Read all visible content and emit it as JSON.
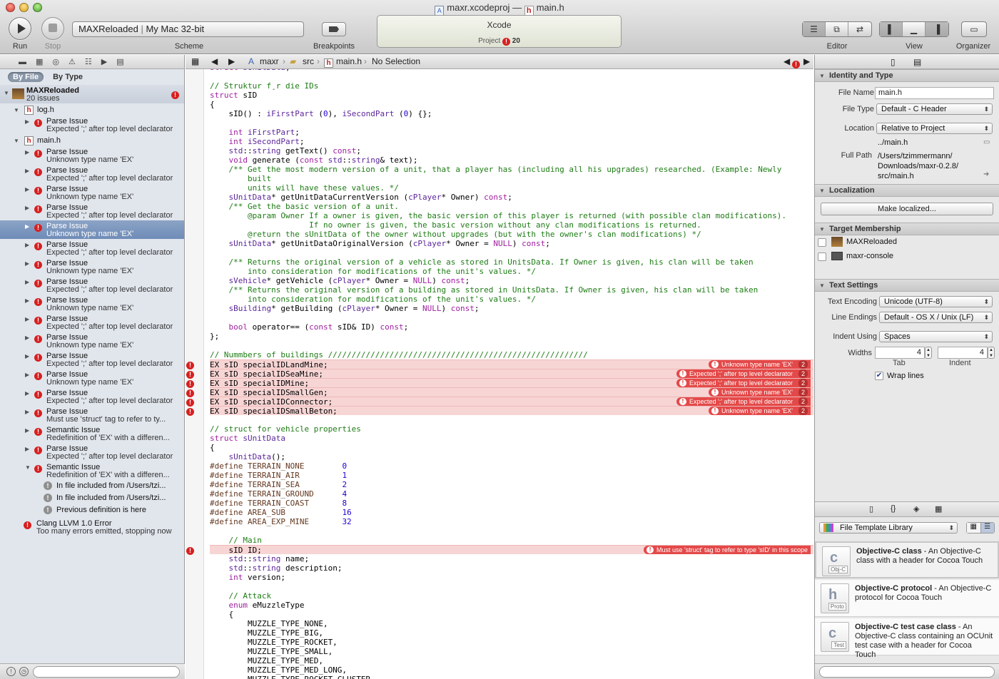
{
  "window": {
    "title_file1": "maxr.xcodeproj",
    "title_sep": "—",
    "title_file2": "main.h"
  },
  "toolbar": {
    "run_label": "Run",
    "stop_label": "Stop",
    "scheme_target": "MAXReloaded",
    "scheme_dest": "My Mac 32-bit",
    "scheme_label": "Scheme",
    "breakpoints_label": "Breakpoints",
    "activity_title": "Xcode",
    "activity_project": "Project",
    "activity_errors": "20",
    "editor_label": "Editor",
    "view_label": "View",
    "organizer_label": "Organizer"
  },
  "navigator": {
    "scope_by_file": "By File",
    "scope_by_type": "By Type",
    "project_name": "MAXReloaded",
    "project_issues": "20 issues",
    "files": [
      {
        "name": "log.h",
        "issues": [
          {
            "title": "Parse Issue",
            "detail": "Expected ';' after top level declarator"
          }
        ]
      },
      {
        "name": "main.h",
        "issues": [
          {
            "title": "Parse Issue",
            "detail": "Unknown type name 'EX'"
          },
          {
            "title": "Parse Issue",
            "detail": "Expected ';' after top level declarator"
          },
          {
            "title": "Parse Issue",
            "detail": "Unknown type name 'EX'"
          },
          {
            "title": "Parse Issue",
            "detail": "Expected ';' after top level declarator"
          },
          {
            "title": "Parse Issue",
            "detail": "Unknown type name 'EX'"
          },
          {
            "title": "Parse Issue",
            "detail": "Expected ';' after top level declarator"
          },
          {
            "title": "Parse Issue",
            "detail": "Unknown type name 'EX'"
          },
          {
            "title": "Parse Issue",
            "detail": "Expected ';' after top level declarator"
          },
          {
            "title": "Parse Issue",
            "detail": "Unknown type name 'EX'"
          },
          {
            "title": "Parse Issue",
            "detail": "Expected ';' after top level declarator"
          },
          {
            "title": "Parse Issue",
            "detail": "Unknown type name 'EX'"
          },
          {
            "title": "Parse Issue",
            "detail": "Expected ';' after top level declarator"
          },
          {
            "title": "Parse Issue",
            "detail": "Unknown type name 'EX'"
          },
          {
            "title": "Parse Issue",
            "detail": "Expected ';' after top level declarator"
          },
          {
            "title": "Parse Issue",
            "detail": "Must use 'struct' tag to refer to ty..."
          },
          {
            "title": "Semantic Issue",
            "detail": "Redefinition of 'EX' with a differen..."
          },
          {
            "title": "Parse Issue",
            "detail": "Expected ';' after top level declarator"
          },
          {
            "title": "Semantic Issue",
            "detail": "Redefinition of 'EX' with a differen..."
          }
        ]
      },
      {
        "notes": [
          "In file included from /Users/tzi...",
          "In file included from /Users/tzi...",
          "Previous definition is here"
        ]
      }
    ],
    "clang_title": "Clang LLVM 1.0 Error",
    "clang_detail": "Too many errors emitted, stopping now",
    "selected_index": 5
  },
  "jumpbar": {
    "project": "maxr",
    "folder": "src",
    "file": "main.h",
    "symbol": "No Selection"
  },
  "code": {
    "lines": [
      "struct sUnitData;",
      "",
      "// Struktur f¸r die IDs",
      "struct sID",
      "{",
      "    sID() : iFirstPart (0), iSecondPart (0) {};",
      "",
      "    int iFirstPart;",
      "    int iSecondPart;",
      "    std::string getText() const;",
      "    void generate (const std::string& text);",
      "    /** Get the most modern version of a unit, that a player has (including all his upgrades) researched. (Example: Newly",
      "        built",
      "        units will have these values. */",
      "    sUnitData* getUnitDataCurrentVersion (cPlayer* Owner) const;",
      "    /** Get the basic version of a unit.",
      "        @param Owner If a owner is given, the basic version of this player is returned (with possible clan modifications).",
      "                     If no owner is given, the basic version without any clan modifications is returned.",
      "        @return the sUnitData of the owner without upgrades (but with the owner's clan modifications) */",
      "    sUnitData* getUnitDataOriginalVersion (cPlayer* Owner = NULL) const;",
      "",
      "    /** Returns the original version of a vehicle as stored in UnitsData. If Owner is given, his clan will be taken",
      "        into consideration for modifications of the unit's values. */",
      "    sVehicle* getVehicle (cPlayer* Owner = NULL) const;",
      "    /** Returns the original version of a building as stored in UnitsData. If Owner is given, his clan will be taken",
      "        into consideration for modifications of the unit's values. */",
      "    sBuilding* getBuilding (cPlayer* Owner = NULL) const;",
      "",
      "    bool operator== (const sID& ID) const;",
      "};",
      "",
      "// Nummbers of buildings ///////////////////////////////////////////////////////",
      "EX sID specialIDLandMine;",
      "EX sID specialIDSeaMine;",
      "EX sID specialIDMine;",
      "EX sID specialIDSmallGen;",
      "EX sID specialIDConnector;",
      "EX sID specialIDSmallBeton;",
      "",
      "// struct for vehicle properties",
      "struct sUnitData",
      "{",
      "    sUnitData();",
      "#define TERRAIN_NONE        0",
      "#define TERRAIN_AIR         1",
      "#define TERRAIN_SEA         2",
      "#define TERRAIN_GROUND      4",
      "#define TERRAIN_COAST       8",
      "#define AREA_SUB            16",
      "#define AREA_EXP_MINE       32",
      "",
      "    // Main",
      "    sID ID;",
      "    std::string name;",
      "    std::string description;",
      "    int version;",
      "",
      "    // Attack",
      "    enum eMuzzleType",
      "    {",
      "        MUZZLE_TYPE_NONE,",
      "        MUZZLE_TYPE_BIG,",
      "        MUZZLE_TYPE_ROCKET,",
      "        MUZZLE_TYPE_SMALL,",
      "        MUZZLE_TYPE_MED,",
      "        MUZZLE_TYPE_MED_LONG,",
      "        MUZZLE_TYPE_ROCKET_CLUSTER,"
    ],
    "errors": [
      {
        "line": 32,
        "message": "Unknown type name 'EX'",
        "count": "2"
      },
      {
        "line": 33,
        "message": "Expected ';' after top level declarator",
        "count": "2"
      },
      {
        "line": 34,
        "message": "Expected ';' after top level declarator",
        "count": "2"
      },
      {
        "line": 35,
        "message": "Unknown type name 'EX'",
        "count": "2"
      },
      {
        "line": 36,
        "message": "Expected ';' after top level declarator",
        "count": "2"
      },
      {
        "line": 37,
        "message": "Unknown type name 'EX'",
        "count": "2"
      },
      {
        "line": 52,
        "message": "Must use 'struct' tag to refer to type 'sID' in this scope",
        "count": ""
      }
    ]
  },
  "inspector": {
    "identity_title": "Identity and Type",
    "file_name_label": "File Name",
    "file_name_value": "main.h",
    "file_type_label": "File Type",
    "file_type_value": "Default - C Header",
    "location_label": "Location",
    "location_value": "Relative to Project",
    "location_path": "../main.h",
    "full_path_label": "Full Path",
    "full_path_1": "/Users/tzimmermann/",
    "full_path_2": "Downloads/maxr-0.2.8/",
    "full_path_3": "src/main.h",
    "localization_title": "Localization",
    "make_localized": "Make localized...",
    "target_title": "Target Membership",
    "target_1": "MAXReloaded",
    "target_2": "maxr-console",
    "text_title": "Text Settings",
    "encoding_label": "Text Encoding",
    "encoding_value": "Unicode (UTF-8)",
    "endings_label": "Line Endings",
    "endings_value": "Default - OS X / Unix (LF)",
    "indent_using_label": "Indent Using",
    "indent_using_value": "Spaces",
    "widths_label": "Widths",
    "tab_value": "4",
    "indent_value": "4",
    "tab_label": "Tab",
    "indent_label": "Indent",
    "wrap_label": "Wrap lines",
    "library_select": "File Template Library",
    "templates": [
      {
        "name": "Objective-C class",
        "desc": " - An Objective-C class with a header for Cocoa Touch",
        "tag": "Obj-C"
      },
      {
        "name": "Objective-C protocol",
        "desc": " - An Objective-C protocol for Cocoa Touch",
        "tag": "Proto"
      },
      {
        "name": "Objective-C test case class",
        "desc": " - An Objective-C class containing an OCUnit test case with a header for Cocoa Touch",
        "tag": "Test"
      }
    ]
  }
}
